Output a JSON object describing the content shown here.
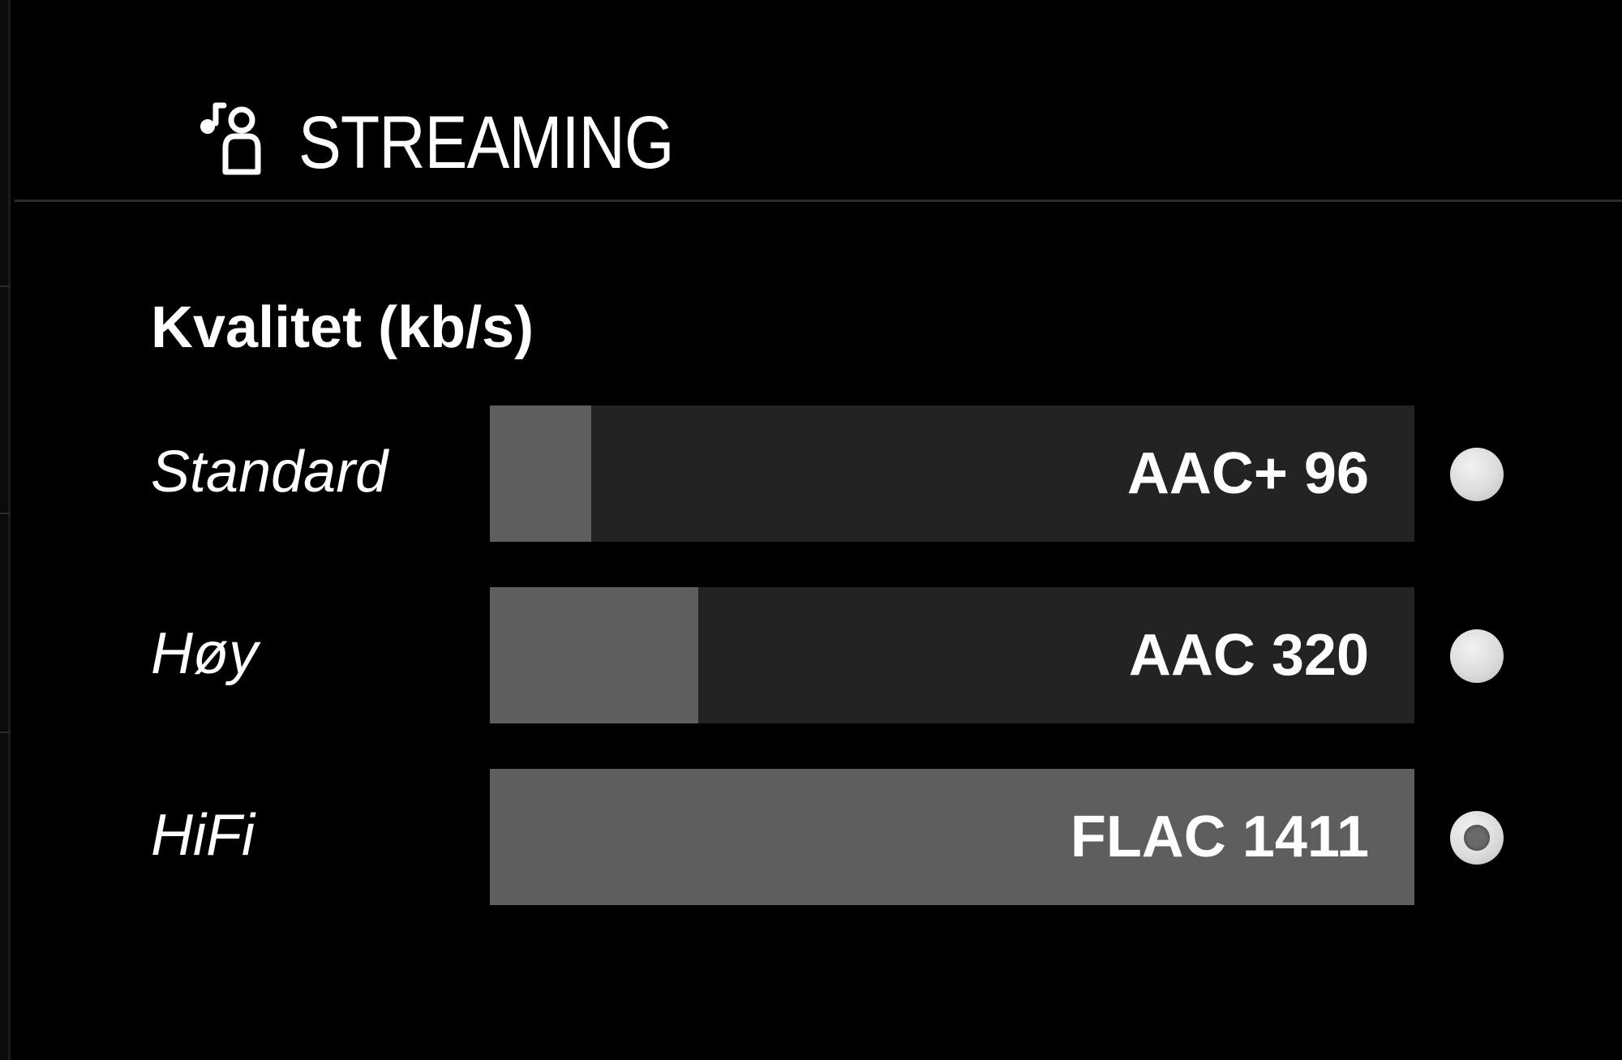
{
  "header": {
    "icon": "music-user-icon",
    "title": "STREAMING"
  },
  "quality": {
    "title": "Kvalitet (kb/s)",
    "options": [
      {
        "label": "Standard",
        "value": "AAC+ 96",
        "level": 0.11,
        "selected": false
      },
      {
        "label": "Høy",
        "value": "AAC 320",
        "level": 0.225,
        "selected": false
      },
      {
        "label": "HiFi",
        "value": "FLAC 1411",
        "level": 1.0,
        "selected": true
      }
    ]
  },
  "colors": {
    "background": "#000000",
    "bar_track": "#232323",
    "bar_fill": "#5e5e5e",
    "text": "#ffffff"
  }
}
